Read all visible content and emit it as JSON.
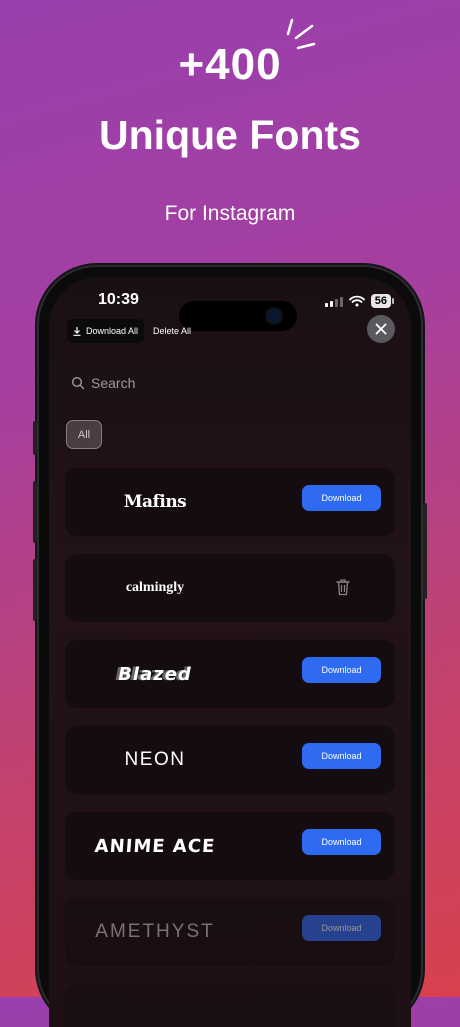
{
  "promo": {
    "count": "+400",
    "headline": "Unique Fonts",
    "subtitle": "For Instagram"
  },
  "status_bar": {
    "time": "10:39",
    "battery": "56"
  },
  "toolbar": {
    "download_all": "Download All",
    "delete_all": "Delete All"
  },
  "search": {
    "placeholder": "Search"
  },
  "filters": {
    "active": "All"
  },
  "fonts": [
    {
      "name": "Mafins",
      "action": "Download"
    },
    {
      "name": "calmingly",
      "action": "installed"
    },
    {
      "name": "Blazed",
      "action": "Download"
    },
    {
      "name": "NEON",
      "action": "Download"
    },
    {
      "name": "ANIME ACE",
      "action": "Download"
    },
    {
      "name": "AMETHYST",
      "action": "Download"
    }
  ],
  "colors": {
    "accent_blue": "#2e6bf0",
    "background_top": "#9a3fae",
    "background_bottom": "#d8414e"
  }
}
